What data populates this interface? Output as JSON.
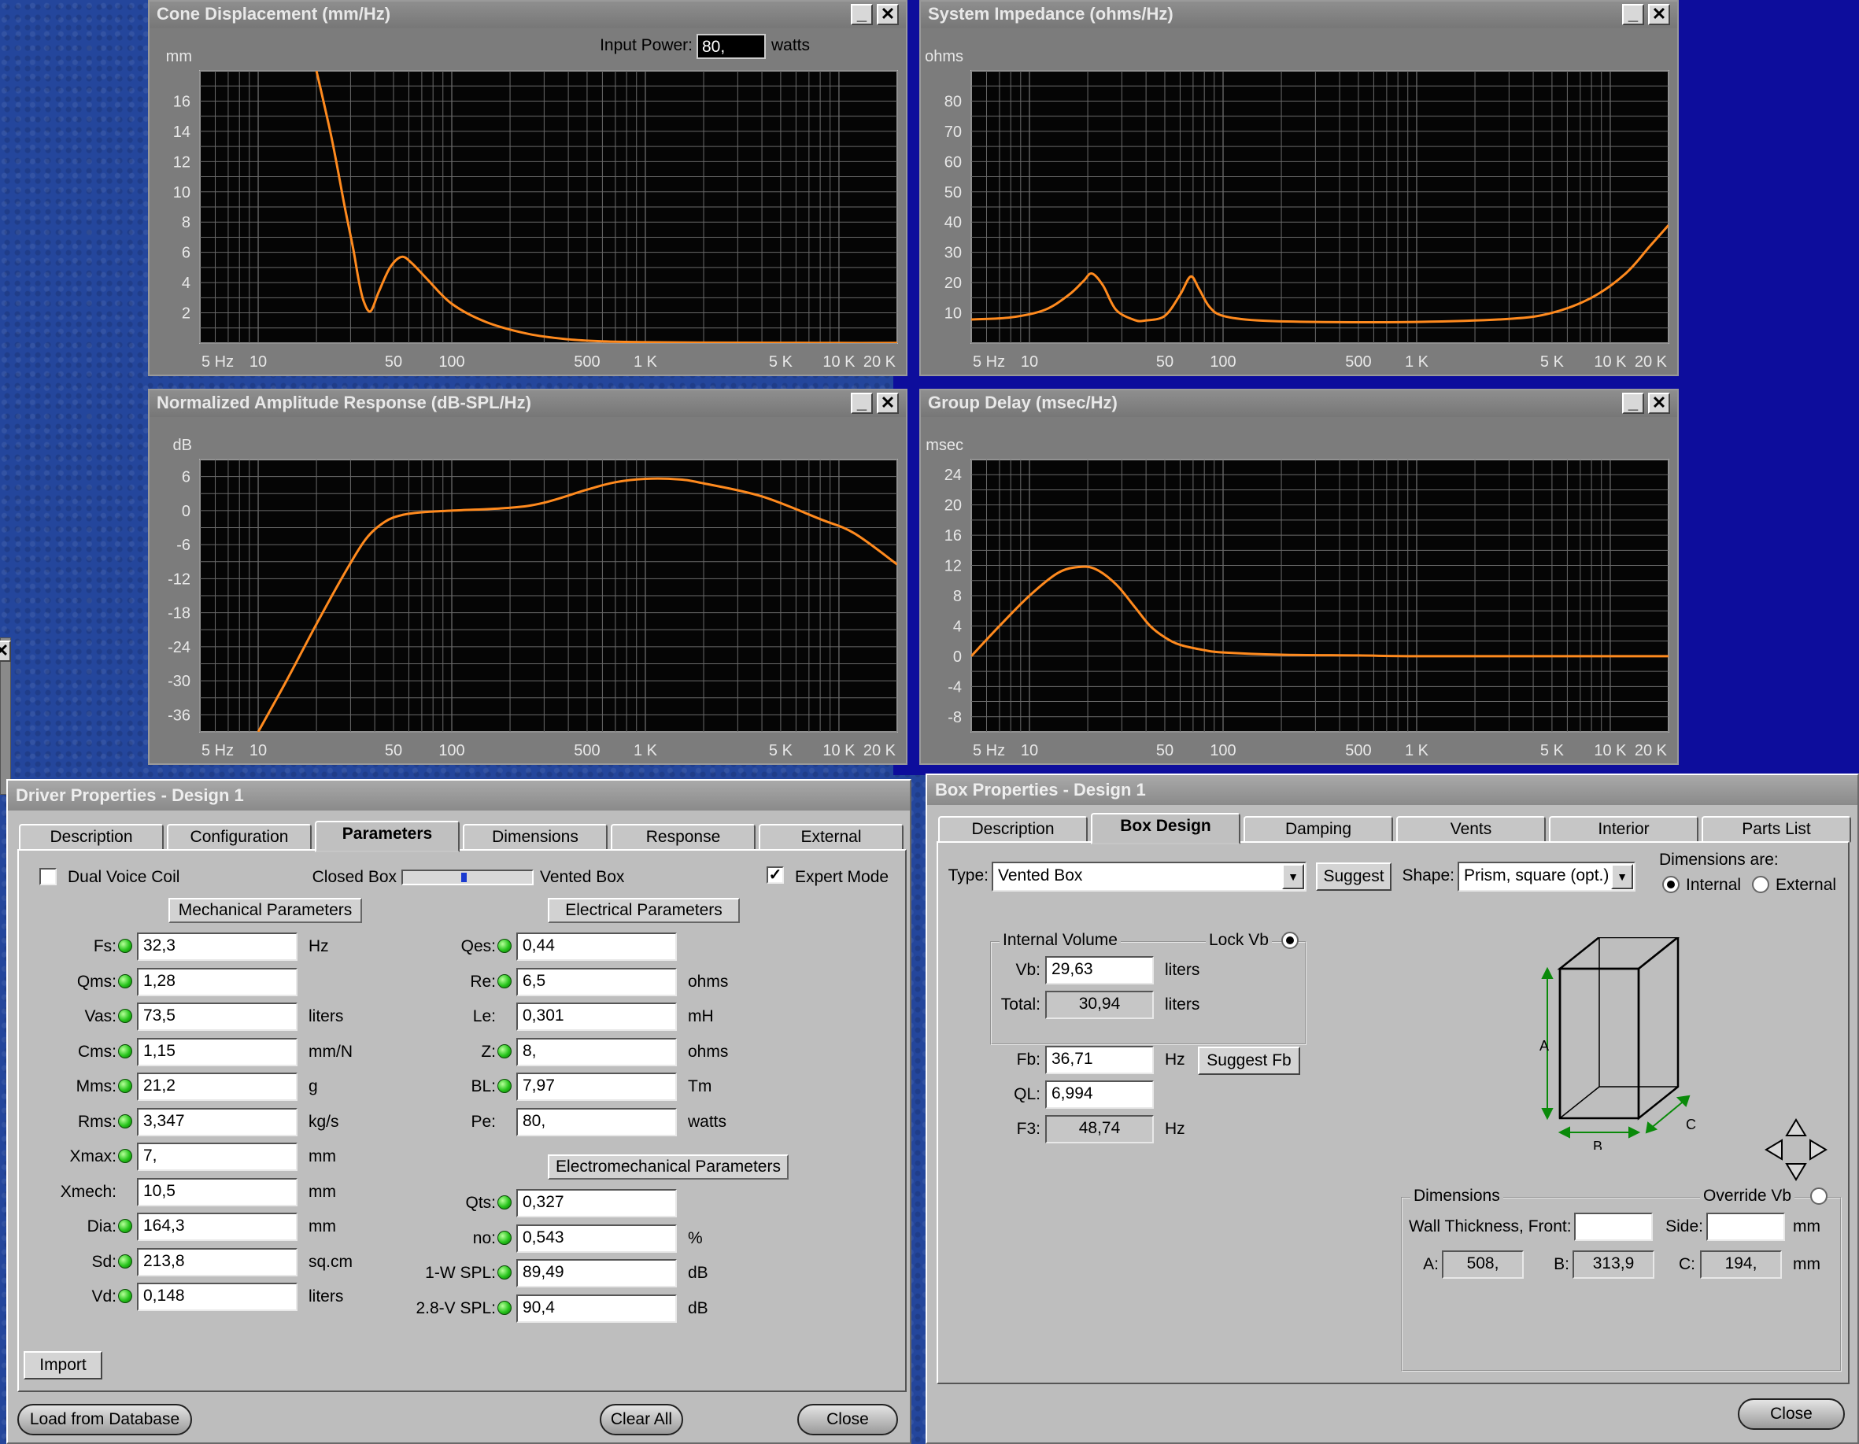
{
  "charts": {
    "cone": {
      "title": "Cone Displacement (mm/Hz)",
      "unit": "mm",
      "extra": {
        "label": "Input Power:",
        "value": "80,",
        "unit": "watts"
      },
      "chart_data": {
        "type": "line",
        "title": "Cone Displacement (mm/Hz)",
        "ylabel": "mm",
        "xscale": "log",
        "xlim": [
          5,
          20000
        ],
        "ylim": [
          0,
          18
        ],
        "yticks": [
          2,
          4,
          6,
          8,
          10,
          12,
          14,
          16
        ],
        "xticklabels": [
          "5 Hz",
          "10",
          "50",
          "100",
          "500",
          "1 K",
          "5 K",
          "10 K",
          "20 K"
        ],
        "series": [
          {
            "x": [
              20,
              24,
              28,
              31,
              33,
              35,
              38,
              42,
              48,
              55,
              62,
              75,
              100,
              150,
              250,
              400,
              600,
              1000,
              2000,
              5000,
              10000,
              20000
            ],
            "y": [
              18,
              13.5,
              9,
              6.2,
              4.2,
              2.8,
              2.1,
              3.4,
              5,
              5.7,
              5.3,
              4.2,
              2.6,
              1.4,
              0.6,
              0.25,
              0.12,
              0.06,
              0.03,
              0.02,
              0.01,
              0.01
            ]
          }
        ]
      }
    },
    "impedance": {
      "title": "System Impedance (ohms/Hz)",
      "unit": "ohms",
      "chart_data": {
        "type": "line",
        "title": "System Impedance (ohms/Hz)",
        "ylabel": "ohms",
        "xscale": "log",
        "xlim": [
          5,
          20000
        ],
        "ylim": [
          0,
          90
        ],
        "yticks": [
          10,
          20,
          30,
          40,
          50,
          60,
          70,
          80
        ],
        "xticklabels": [
          "5 Hz",
          "10",
          "50",
          "100",
          "500",
          "1 K",
          "5 K",
          "10 K",
          "20 K"
        ],
        "series": [
          {
            "x": [
              5,
              8,
              12,
              16,
              19,
              21,
              24,
              28,
              35,
              40,
              50,
              60,
              68,
              75,
              85,
              100,
              150,
              300,
              1000,
              3000,
              5000,
              8000,
              12000,
              16000,
              20000
            ],
            "y": [
              7.8,
              8.5,
              11,
              16,
              20.5,
              23,
              19,
              11,
              7.6,
              7.5,
              9,
              16,
              22,
              18,
              12,
              9,
              7.5,
              7,
              7,
              8,
              10,
              15,
              23,
              32,
              39
            ]
          }
        ]
      }
    },
    "spl": {
      "title": "Normalized Amplitude Response (dB-SPL/Hz)",
      "unit": "dB",
      "chart_data": {
        "type": "line",
        "title": "Normalized Amplitude Response (dB-SPL/Hz)",
        "ylabel": "dB",
        "xscale": "log",
        "xlim": [
          5,
          20000
        ],
        "ylim": [
          -39,
          9
        ],
        "yticks": [
          -36,
          -30,
          -24,
          -18,
          -12,
          -6,
          0,
          6
        ],
        "xticklabels": [
          "5 Hz",
          "10",
          "50",
          "100",
          "500",
          "1 K",
          "5 K",
          "10 K",
          "20 K"
        ],
        "series": [
          {
            "x": [
              10,
              14,
              20,
              28,
              36,
              45,
              55,
              70,
              100,
              200,
              300,
              500,
              700,
              1000,
              1500,
              2000,
              4000,
              8000,
              12000,
              20000
            ],
            "y": [
              -39,
              -30,
              -20,
              -11,
              -5,
              -2,
              -0.8,
              -0.3,
              0,
              0.5,
              1.4,
              3.7,
              5,
              5.6,
              5.5,
              4.8,
              2.5,
              -1.5,
              -4,
              -9.5
            ]
          }
        ]
      }
    },
    "delay": {
      "title": "Group Delay (msec/Hz)",
      "unit": "msec",
      "chart_data": {
        "type": "line",
        "title": "Group Delay (msec/Hz)",
        "ylabel": "msec",
        "xscale": "log",
        "xlim": [
          5,
          20000
        ],
        "ylim": [
          -10,
          26
        ],
        "yticks": [
          -8,
          -4,
          0,
          4,
          8,
          12,
          16,
          20,
          24
        ],
        "xticklabels": [
          "5 Hz",
          "10",
          "50",
          "100",
          "500",
          "1 K",
          "5 K",
          "10 K",
          "20 K"
        ],
        "series": [
          {
            "x": [
              5,
              7,
              10,
              14,
              18,
              22,
              28,
              35,
              42,
              50,
              60,
              80,
              100,
              200,
              500,
              1000,
              5000,
              20000
            ],
            "y": [
              0,
              4,
              8,
              11,
              11.8,
              11.5,
              9.5,
              6.5,
              4,
              2.5,
              1.5,
              0.8,
              0.5,
              0.2,
              0.1,
              0,
              0,
              0
            ]
          }
        ]
      }
    }
  },
  "driver": {
    "title": "Driver Properties - Design 1",
    "tabs": [
      "Description",
      "Configuration",
      "Parameters",
      "Dimensions",
      "Response",
      "External"
    ],
    "dual_voice_coil": "Dual Voice Coil",
    "closed_box": "Closed Box",
    "slider_pos": 0.45,
    "vented_box": "Vented Box",
    "expert_mode": "Expert Mode",
    "mech_header": "Mechanical Parameters",
    "elec_header": "Electrical Parameters",
    "em_header": "Electromechanical Parameters",
    "mech": [
      {
        "label": "Fs:",
        "value": "32,3",
        "unit": "Hz",
        "led": true
      },
      {
        "label": "Qms:",
        "value": "1,28",
        "unit": "",
        "led": true
      },
      {
        "label": "Vas:",
        "value": "73,5",
        "unit": "liters",
        "led": true
      },
      {
        "label": "Cms:",
        "value": "1,15",
        "unit": "mm/N",
        "led": true
      },
      {
        "label": "Mms:",
        "value": "21,2",
        "unit": "g",
        "led": true
      },
      {
        "label": "Rms:",
        "value": "3,347",
        "unit": "kg/s",
        "led": true
      },
      {
        "label": "Xmax:",
        "value": "7,",
        "unit": "mm",
        "led": true
      },
      {
        "label": "Xmech:",
        "value": "10,5",
        "unit": "mm",
        "led": false
      },
      {
        "label": "Dia:",
        "value": "164,3",
        "unit": "mm",
        "led": true
      },
      {
        "label": "Sd:",
        "value": "213,8",
        "unit": "sq.cm",
        "led": true
      },
      {
        "label": "Vd:",
        "value": "0,148",
        "unit": "liters",
        "led": true
      }
    ],
    "elec": [
      {
        "label": "Qes:",
        "value": "0,44",
        "unit": "",
        "led": true
      },
      {
        "label": "Re:",
        "value": "6,5",
        "unit": "ohms",
        "led": true
      },
      {
        "label": "Le:",
        "value": "0,301",
        "unit": "mH",
        "led": false
      },
      {
        "label": "Z:",
        "value": "8,",
        "unit": "ohms",
        "led": true
      },
      {
        "label": "BL:",
        "value": "7,97",
        "unit": "Tm",
        "led": true
      },
      {
        "label": "Pe:",
        "value": "80,",
        "unit": "watts",
        "led": false
      }
    ],
    "em": [
      {
        "label": "Qts:",
        "value": "0,327",
        "unit": "",
        "led": true
      },
      {
        "label": "no:",
        "value": "0,543",
        "unit": "%",
        "led": true
      },
      {
        "label": "1-W SPL:",
        "value": "89,49",
        "unit": "dB",
        "led": true
      },
      {
        "label": "2.8-V SPL:",
        "value": "90,4",
        "unit": "dB",
        "led": true
      }
    ],
    "import": "Import",
    "load_db": "Load from Database",
    "clear_all": "Clear All",
    "close": "Close"
  },
  "box": {
    "title": "Box Properties - Design 1",
    "tabs": [
      "Description",
      "Box Design",
      "Damping",
      "Vents",
      "Interior",
      "Parts List"
    ],
    "type_label": "Type:",
    "type_value": "Vented Box",
    "suggest": "Suggest",
    "shape_label": "Shape:",
    "shape_value": "Prism, square (opt.)",
    "dims_are": "Dimensions are:",
    "internal": "Internal",
    "external": "External",
    "internal_volume": "Internal Volume",
    "lock_vb": "Lock Vb",
    "vb_label": "Vb:",
    "vb": "29,63",
    "vb_unit": "liters",
    "total_label": "Total:",
    "total": "30,94",
    "total_unit": "liters",
    "fb_label": "Fb:",
    "fb": "36,71",
    "fb_unit": "Hz",
    "suggest_fb": "Suggest Fb",
    "ql_label": "QL:",
    "ql": "6,994",
    "f3_label": "F3:",
    "f3": "48,74",
    "f3_unit": "Hz",
    "dimensions": "Dimensions",
    "override_vb": "Override Vb",
    "wall_front": "Wall Thickness, Front:",
    "side": "Side:",
    "mm": "mm",
    "a_label": "A:",
    "a": "508,",
    "b_label": "B:",
    "b": "313,9",
    "c_label": "C:",
    "c": "194,",
    "diag_a": "A",
    "diag_b": "B",
    "diag_c": "C",
    "close": "Close"
  }
}
